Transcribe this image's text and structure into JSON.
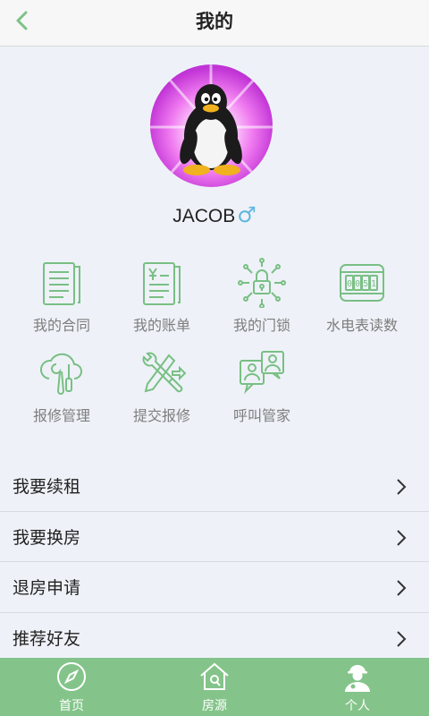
{
  "header": {
    "title": "我的",
    "back_icon": "chevron-left-icon"
  },
  "profile": {
    "avatar_icon": "penguin-avatar",
    "name": "JACOB",
    "gender_symbol": "♂"
  },
  "grid": [
    {
      "label": "我的合同",
      "icon": "contract-icon"
    },
    {
      "label": "我的账单",
      "icon": "bill-icon"
    },
    {
      "label": "我的门锁",
      "icon": "smart-lock-icon"
    },
    {
      "label": "水电表读数",
      "icon": "meter-icon"
    },
    {
      "label": "报修管理",
      "icon": "cloud-tools-icon"
    },
    {
      "label": "提交报修",
      "icon": "repair-tools-icon"
    },
    {
      "label": "呼叫管家",
      "icon": "call-steward-icon"
    }
  ],
  "menu": [
    {
      "label": "我要续租"
    },
    {
      "label": "我要换房"
    },
    {
      "label": "退房申请"
    },
    {
      "label": "推荐好友"
    }
  ],
  "tabs": [
    {
      "label": "首页",
      "icon": "compass-icon"
    },
    {
      "label": "房源",
      "icon": "house-icon"
    },
    {
      "label": "个人",
      "icon": "person-icon"
    }
  ],
  "colors": {
    "accent": "#84c48a",
    "icon_green": "#79bf84",
    "background": "#eef2f8",
    "gender_blue": "#5fb7de"
  }
}
